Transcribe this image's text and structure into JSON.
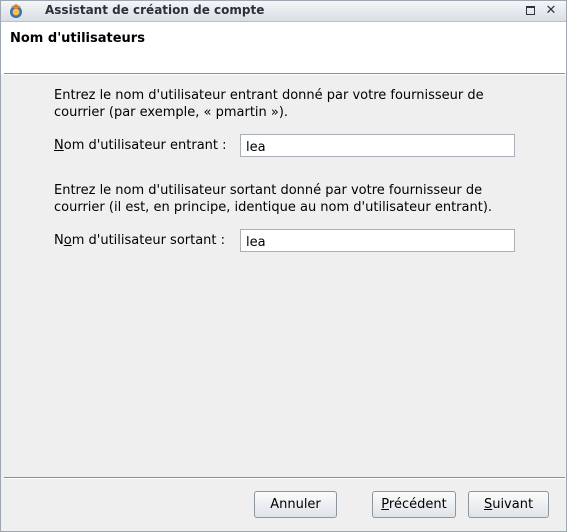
{
  "window": {
    "title": "Assistant de création de compte",
    "maximize_icon": "maximize-icon",
    "close_icon": "close-icon",
    "close_glyph": "✕"
  },
  "header": {
    "title": "Nom d'utilisateurs"
  },
  "incoming": {
    "description": "Entrez le nom d'utilisateur entrant donné par votre fournisseur de\ncourrier (par exemple, « pmartin »).",
    "label_access": "N",
    "label_rest": "om d'utilisateur entrant :",
    "value": "lea"
  },
  "outgoing": {
    "description": "Entrez le nom d'utilisateur sortant donné par votre fournisseur de\ncourrier (il est, en principe, identique au nom d'utilisateur entrant).",
    "label_start": "N",
    "label_access": "o",
    "label_rest": "m d'utilisateur sortant :",
    "value": "lea"
  },
  "buttons": {
    "cancel": "Annuler",
    "prev_access": "P",
    "prev_rest": "récédent",
    "next_access": "S",
    "next_rest": "uivant"
  }
}
